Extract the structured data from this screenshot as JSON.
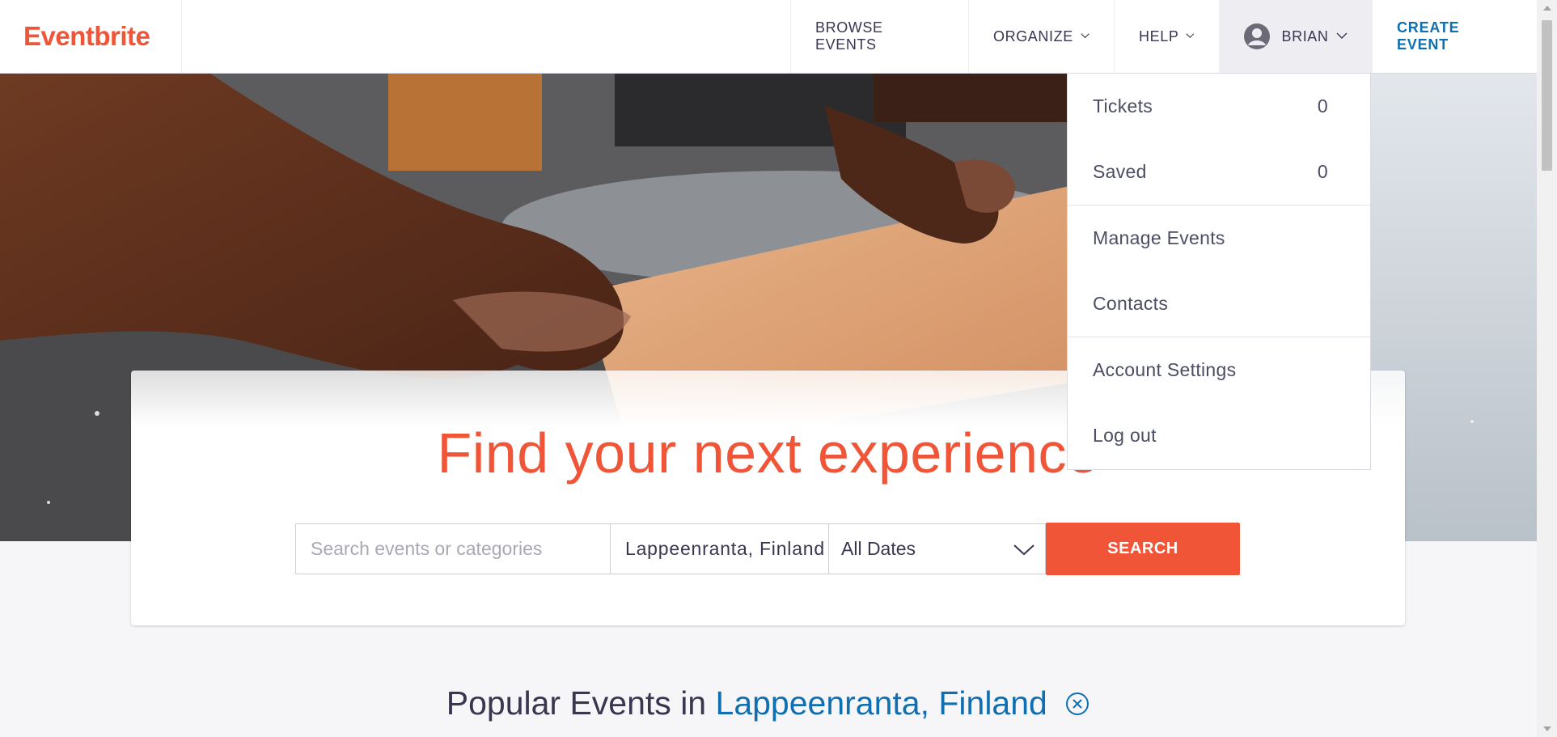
{
  "header": {
    "logo": "Eventbrite",
    "nav": {
      "browse": "BROWSE EVENTS",
      "organize": "ORGANIZE",
      "help": "HELP",
      "user": "BRIAN",
      "create": "CREATE EVENT"
    }
  },
  "user_menu": {
    "tickets_label": "Tickets",
    "tickets_count": "0",
    "saved_label": "Saved",
    "saved_count": "0",
    "manage_events": "Manage Events",
    "contacts": "Contacts",
    "account_settings": "Account Settings",
    "log_out": "Log out"
  },
  "search": {
    "headline": "Find your next experience",
    "query_placeholder": "Search events or categories",
    "location_value": "Lappeenranta, Finland",
    "date_value": "All Dates",
    "button": "SEARCH"
  },
  "popular": {
    "prefix": "Popular Events in",
    "location": "Lappeenranta, Finland"
  },
  "colors": {
    "brand_orange": "#f05537",
    "link_blue": "#0f6fb0",
    "text_dark": "#39364f"
  }
}
